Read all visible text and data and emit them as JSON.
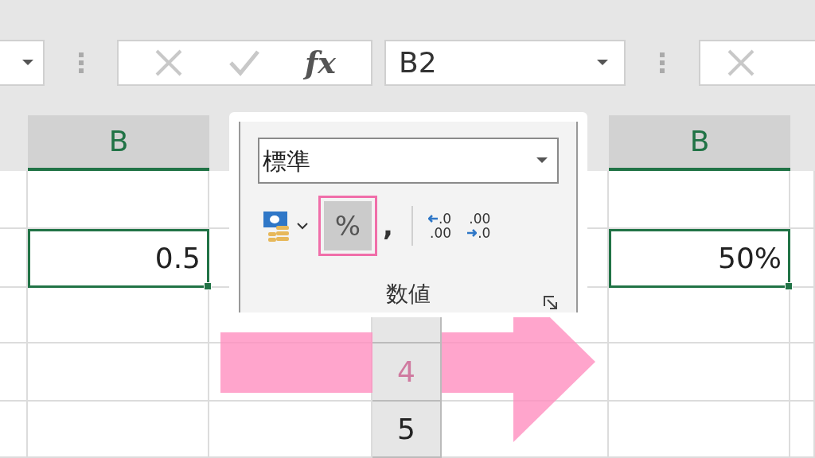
{
  "formula_bar": {
    "fx_label": "fx",
    "name_box": "B2"
  },
  "sheets": [
    {
      "column_header": "B",
      "cell": {
        "value": "0.5",
        "selected": true
      }
    },
    {
      "column_header": "B",
      "cell": {
        "value": "50%",
        "selected": true
      }
    }
  ],
  "row_headers": [
    "4",
    "5"
  ],
  "ribbon_popup": {
    "number_format": "標準",
    "buttons": [
      {
        "kind": "currency",
        "highlighted": false
      },
      {
        "kind": "percent",
        "label": "%",
        "highlighted": true
      },
      {
        "kind": "comma",
        "label": ",",
        "highlighted": false
      },
      {
        "kind": "increase_decimal",
        "top": ".0",
        "bottom": ".00",
        "highlighted": false
      },
      {
        "kind": "decrease_decimal",
        "top": ".00",
        "bottom": ".0",
        "highlighted": false
      }
    ],
    "group_label": "数値"
  }
}
